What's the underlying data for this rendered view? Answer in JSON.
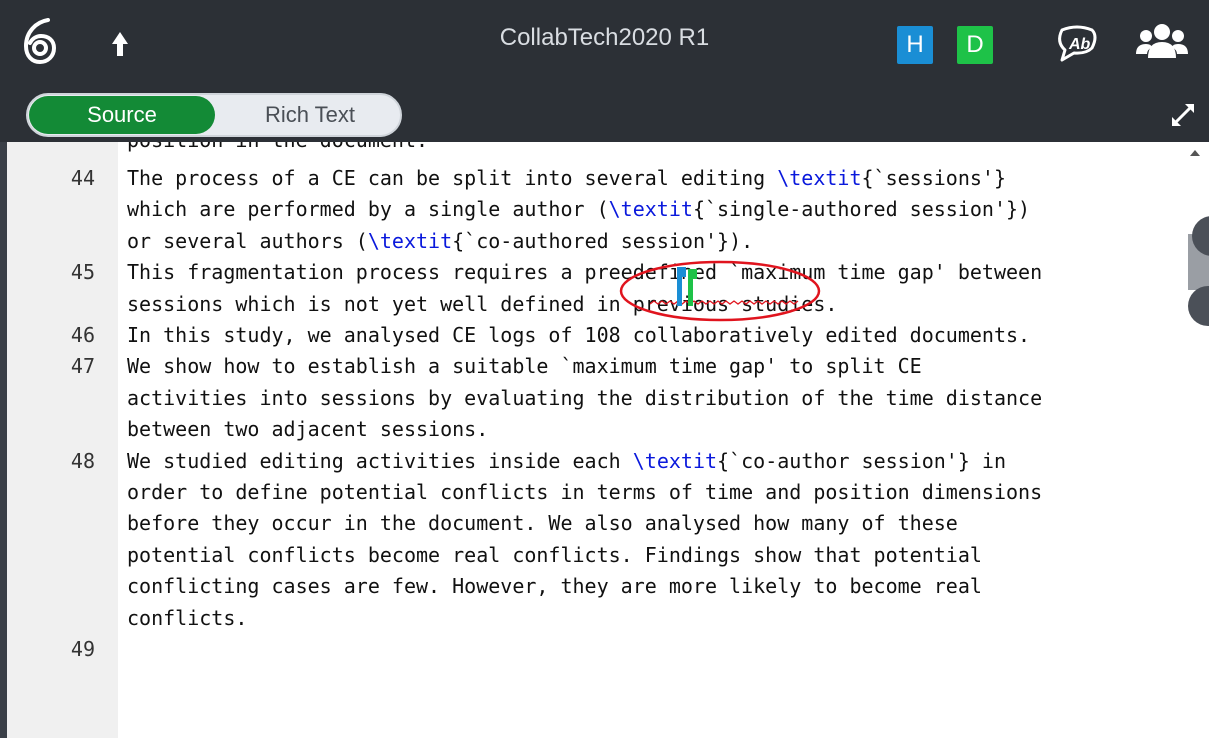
{
  "app": {
    "title": "CollabTech2020 R1",
    "users": [
      {
        "initial": "H",
        "color": "#1a8ed5"
      },
      {
        "initial": "D",
        "color": "#1ec248"
      }
    ]
  },
  "toolbar": {
    "source_label": "Source",
    "rich_text_label": "Rich Text",
    "active_mode": "Source"
  },
  "editor": {
    "clipped_top_line": "position in the document.",
    "lines": [
      {
        "number": "44",
        "rows": [
          [
            {
              "t": "The process of a CE can be split into several editing "
            },
            {
              "t": "\\textit",
              "cmd": true
            },
            {
              "t": "{`sessions'}"
            }
          ],
          [
            {
              "t": "which are performed by a single author ("
            },
            {
              "t": "\\textit",
              "cmd": true
            },
            {
              "t": "{`single-authored session'})"
            }
          ],
          [
            {
              "t": "or several authors ("
            },
            {
              "t": "\\textit",
              "cmd": true
            },
            {
              "t": "{`co-authored session'})."
            }
          ]
        ]
      },
      {
        "number": "45",
        "rows": [
          [
            {
              "t": "This fragmentation process requires a preedefined `maximum time gap' between"
            }
          ],
          [
            {
              "t": "sessions which is not yet well defined in previous studies."
            }
          ]
        ]
      },
      {
        "number": "46",
        "rows": [
          [
            {
              "t": "In this study, we analysed CE logs of 108 collaboratively edited documents."
            }
          ]
        ]
      },
      {
        "number": "47",
        "rows": [
          [
            {
              "t": "We show how to establish a suitable `maximum time gap' to split CE"
            }
          ],
          [
            {
              "t": "activities into sessions by evaluating the distribution of the time distance"
            }
          ],
          [
            {
              "t": "between two adjacent sessions."
            }
          ]
        ]
      },
      {
        "number": "48",
        "rows": [
          [
            {
              "t": "We studied editing activities inside each "
            },
            {
              "t": "\\textit",
              "cmd": true
            },
            {
              "t": "{`co-author session'} in"
            }
          ],
          [
            {
              "t": "order to define potential conflicts in terms of time and position dimensions"
            }
          ],
          [
            {
              "t": "before they occur in the document. We also analysed how many of these"
            }
          ],
          [
            {
              "t": "potential conflicts become real conflicts. Findings show that potential"
            }
          ],
          [
            {
              "t": "conflicting cases are few. However, they are more likely to become real"
            }
          ],
          [
            {
              "t": "conflicts."
            }
          ]
        ]
      },
      {
        "number": "49",
        "rows": [
          [
            {
              "t": ""
            }
          ]
        ]
      }
    ]
  },
  "colors": {
    "topbar": "#2c3036",
    "source_active": "#138a36",
    "latex_command": "#0a19dc",
    "annotation_circle": "#e0141e",
    "spell_error": "#e0141e"
  },
  "icons": {
    "logo": "overleaf-logo-icon",
    "up": "up-arrow-icon",
    "review": "review-chat-icon",
    "chat": "users-icon",
    "expand": "expand-icon"
  }
}
